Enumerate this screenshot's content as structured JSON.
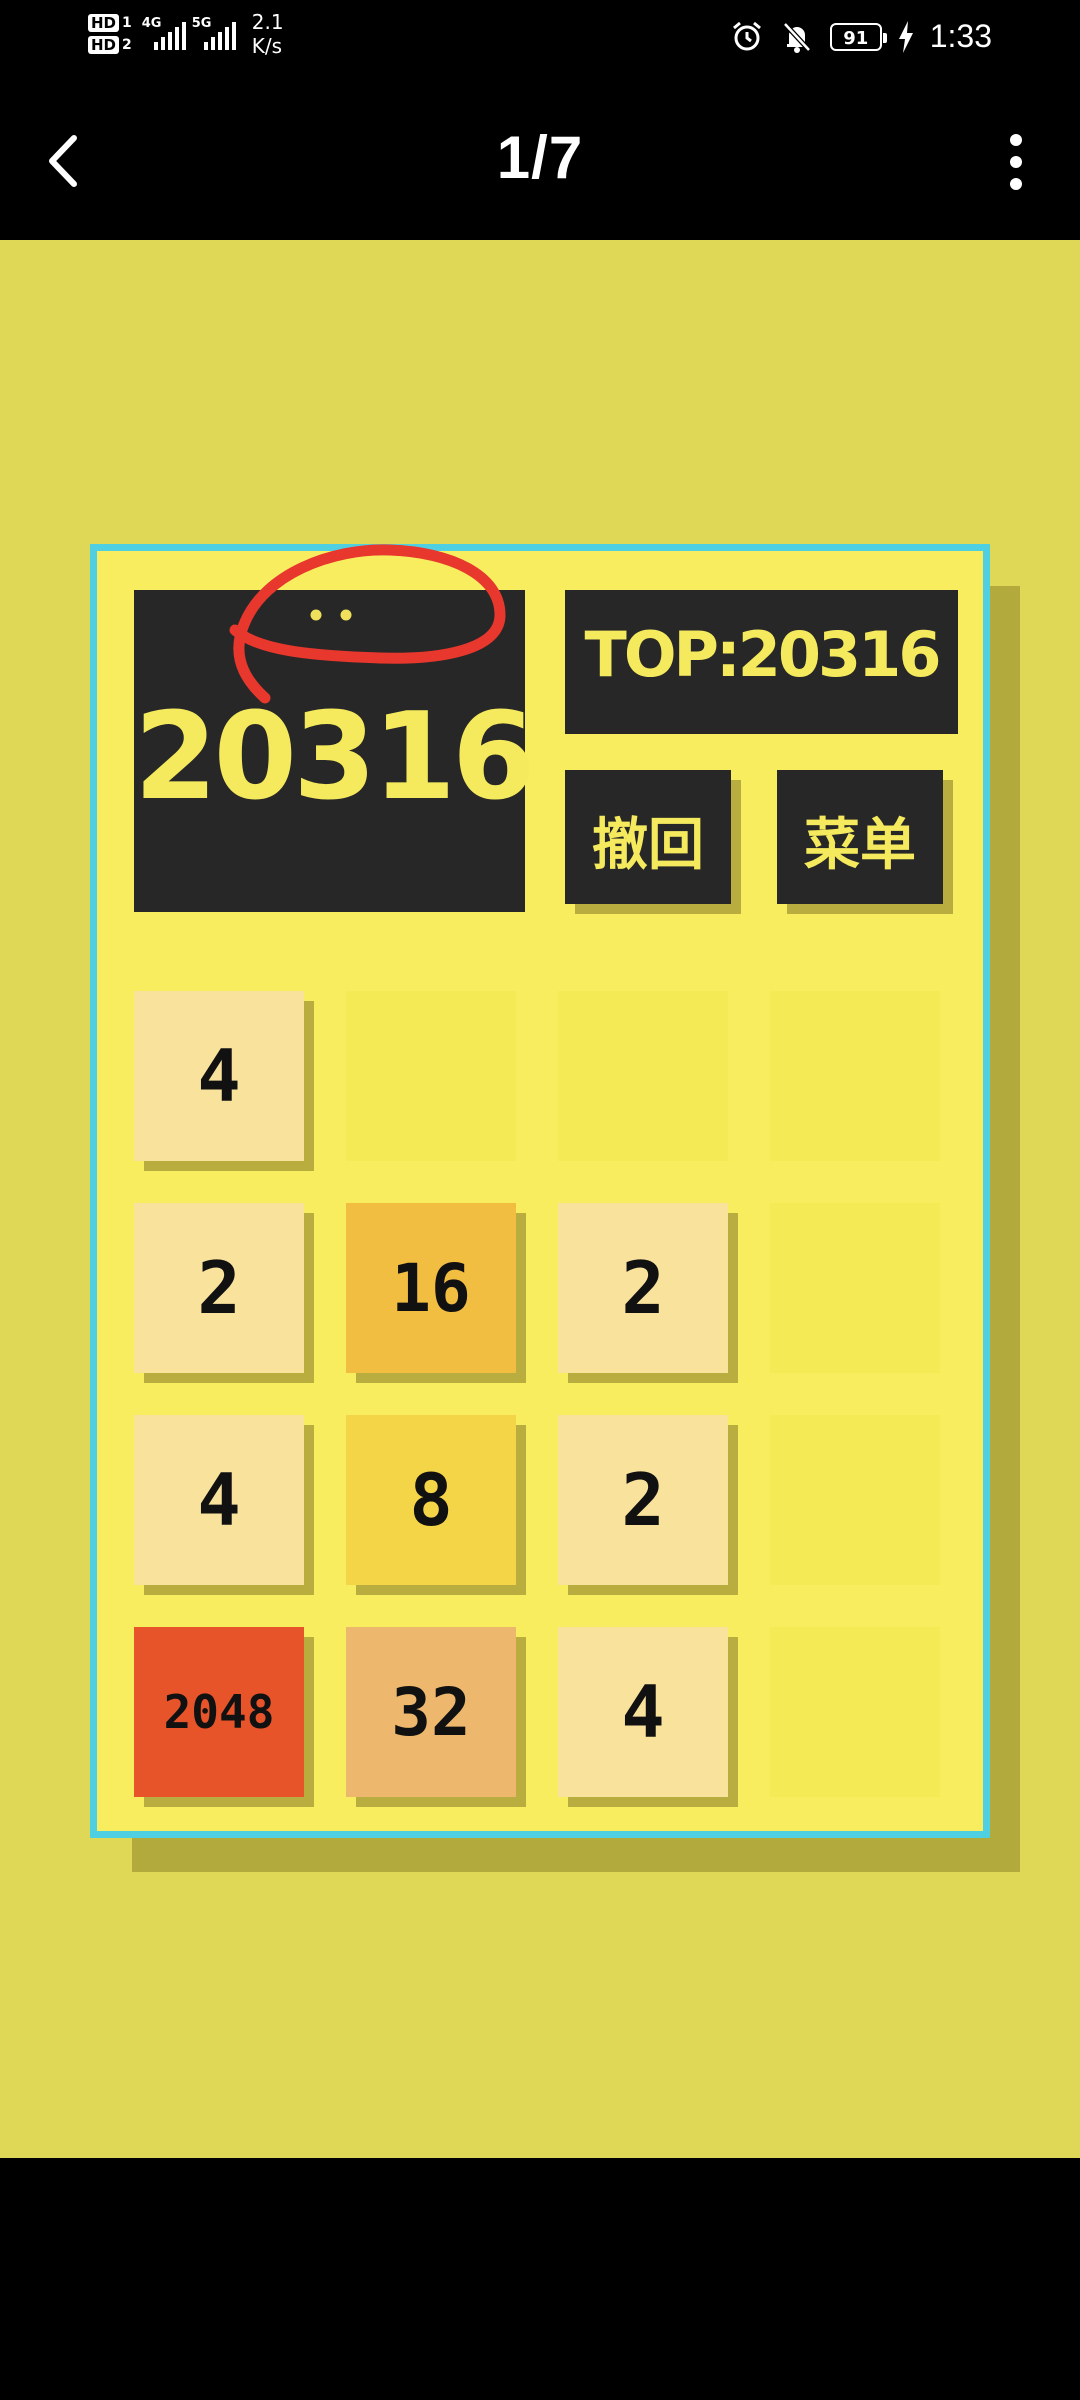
{
  "status_bar": {
    "sim1_label": "HD",
    "sim1_num": "1",
    "sim2_label": "HD",
    "sim2_num": "2",
    "net1": "4G",
    "net2": "5G",
    "speed_value": "2.1",
    "speed_unit": "K/s",
    "battery": "91",
    "time": "1:33",
    "icons": [
      "alarm-icon",
      "mute-bell-icon",
      "charging-bolt-icon"
    ]
  },
  "app_bar": {
    "page_counter": "1/7",
    "back_icon": "chevron-left-icon",
    "more_icon": "more-vertical-icon"
  },
  "game": {
    "score": "20316",
    "top_label": "TOP:20316",
    "undo_label": "撤回",
    "menu_label": "菜单",
    "annotation": "red-circle-with-face-doodle",
    "colors": {
      "background": "#dfd756",
      "board": "#f7ed5f",
      "board_border": "#4fd0e2",
      "dark": "#272727",
      "accent_text": "#f5ea5d"
    },
    "tiles": [
      [
        "4",
        "",
        "",
        ""
      ],
      [
        "2",
        "16",
        "2",
        ""
      ],
      [
        "4",
        "8",
        "2",
        ""
      ],
      [
        "2048",
        "32",
        "4",
        ""
      ]
    ],
    "tile_colors": {
      "2": "#f8e29c",
      "4": "#f8e29c",
      "8": "#f5d548",
      "16": "#f2be42",
      "32": "#edb86e",
      "2048": "#e7542a"
    }
  }
}
